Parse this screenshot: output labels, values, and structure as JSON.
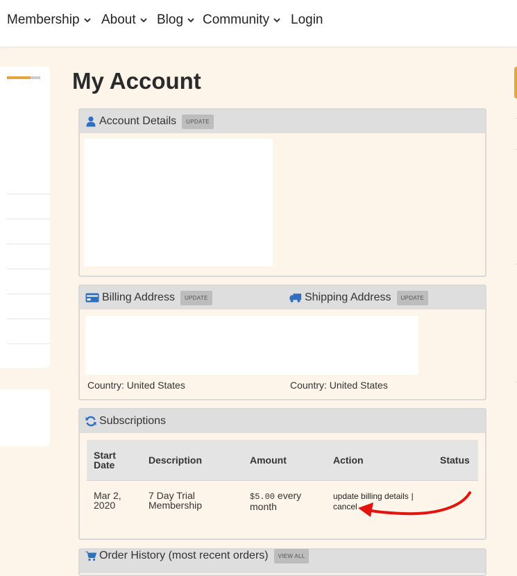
{
  "nav": {
    "items": [
      {
        "label": "Membership",
        "has_dropdown": true
      },
      {
        "label": "About",
        "has_dropdown": true
      },
      {
        "label": "Blog",
        "has_dropdown": true
      },
      {
        "label": "Community",
        "has_dropdown": true
      },
      {
        "label": "Login",
        "has_dropdown": false
      }
    ]
  },
  "sidebar": {
    "progress_fraction": 0.7
  },
  "page": {
    "title": "My Account"
  },
  "account_details": {
    "title": "Account Details",
    "update_label": "UPDATE",
    "icon": "user-icon"
  },
  "addresses": {
    "billing": {
      "title": "Billing Address",
      "update_label": "UPDATE",
      "icon": "credit-card-icon",
      "country": "Country: United States"
    },
    "shipping": {
      "title": "Shipping Address",
      "update_label": "UPDATE",
      "icon": "truck-icon",
      "country": "Country: United States"
    }
  },
  "subscriptions": {
    "title": "Subscriptions",
    "icon": "refresh-icon",
    "columns": [
      "Start Date",
      "Description",
      "Amount",
      "Action",
      "Status"
    ],
    "rows": [
      {
        "start_date": "Mar 2, 2020",
        "description": "7 Day Trial Membership",
        "amount_price": "$5.00",
        "amount_period": "every month",
        "action_update": "update billing details",
        "action_separator": "|",
        "action_cancel": "cancel",
        "status": ""
      }
    ]
  },
  "order_history": {
    "title": "Order History (most recent orders)",
    "view_all_label": "VIEW ALL",
    "icon": "cart-icon"
  },
  "colors": {
    "background": "#fdf5ea",
    "accent": "#e8a33c",
    "icon_blue": "#2d6fc1",
    "annotation_arrow": "#e3130f"
  }
}
